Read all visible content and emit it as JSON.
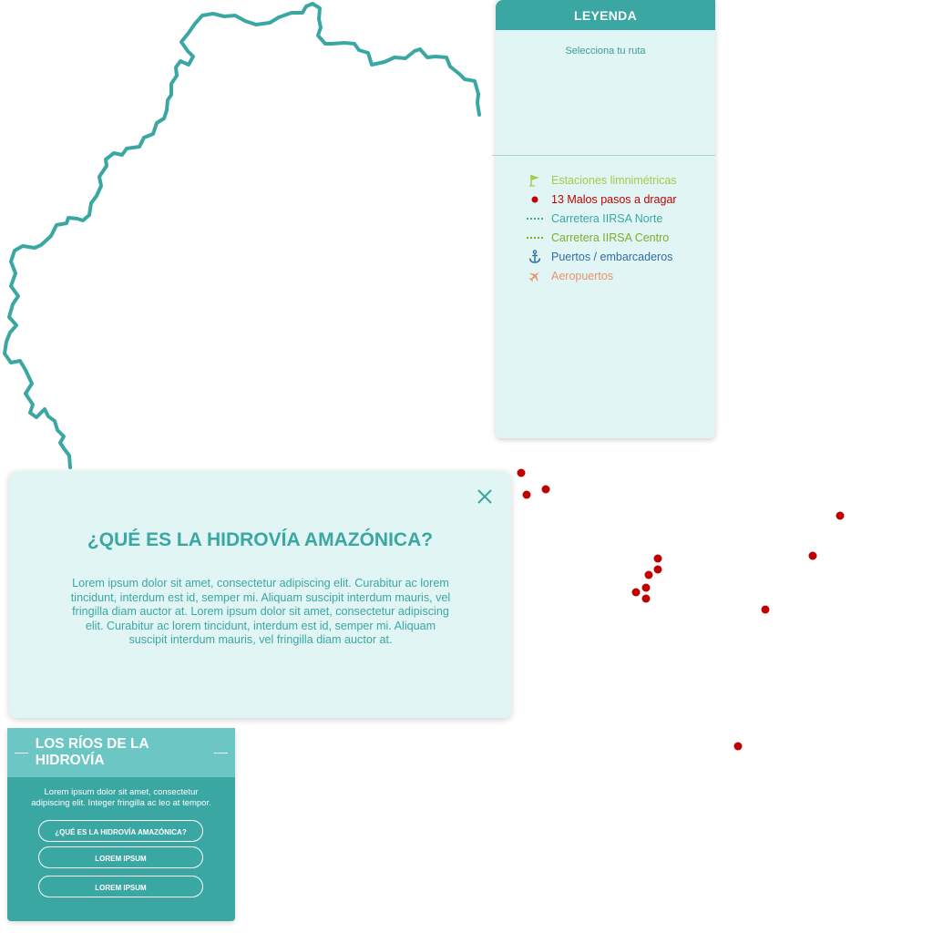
{
  "legend": {
    "title": "LEYENDA",
    "route_prompt": "Selecciona tu ruta",
    "items": [
      {
        "label": "Estaciones limnimétricas",
        "icon": "flag-icon",
        "color": "#a8c94a"
      },
      {
        "label": "13 Malos pasos a dragar",
        "icon": "red-dot-icon",
        "color": "#c00000"
      },
      {
        "label": "Carretera IIRSA Norte",
        "icon": "dotted-line-icon",
        "color": "#3aa7a3"
      },
      {
        "label": "Carretera IIRSA Centro",
        "icon": "dotted-line-icon",
        "color": "#7aae2a"
      },
      {
        "label": "Puertos / embarcaderos",
        "icon": "anchor-icon",
        "color": "#2f6fa3"
      },
      {
        "label": "Aeropuertos",
        "icon": "plane-icon",
        "color": "#e9936a"
      }
    ]
  },
  "modal": {
    "title": "¿QUÉ ES LA HIDROVÍA AMAZÓNICA?",
    "body": "Lorem ipsum dolor sit amet, consectetur adipiscing elit. Curabitur ac lorem tincidunt, interdum est id, semper mi. Aliquam suscipit interdum mauris, vel fringilla diam auctor at. Lorem ipsum dolor sit amet, consectetur adipiscing elit. Curabitur ac lorem tincidunt, interdum est id, semper mi. Aliquam suscipit interdum mauris, vel fringilla diam auctor at."
  },
  "rivers": {
    "title": "LOS RÍOS DE LA HIDROVÍA",
    "description": "Lorem ipsum dolor sit amet, consectetur adipiscing elit. Integer fringilla ac leo at tempor.",
    "buttons": [
      "¿QUÉ ES LA HIDROVÍA AMAZÓNICA?",
      "LOREM IPSUM",
      "LOREM IPSUM"
    ]
  },
  "map": {
    "river_color": "#3aa7a3",
    "marker_color": "#c00000",
    "marker_count": 13
  }
}
